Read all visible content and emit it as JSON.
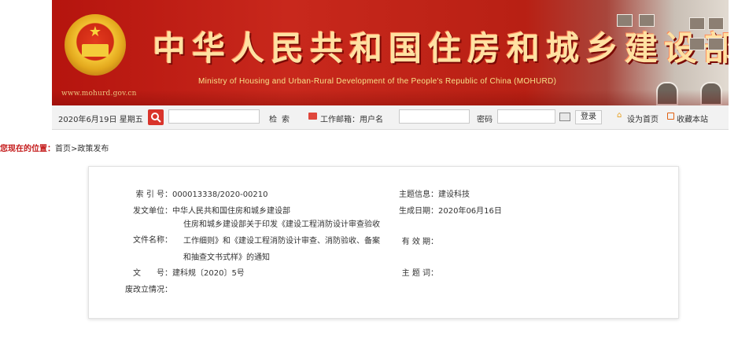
{
  "header": {
    "title_cn": "中华人民共和国住房和城乡建设部",
    "title_en": "Ministry of Housing and Urban-Rural Development of the People's Republic of China (MOHURD)",
    "url": "www.mohurd.gov.cn"
  },
  "toolbar": {
    "date": "2020年6月19日 星期五",
    "search_button": "检索",
    "mail_label": "工作邮箱：用户名",
    "password_label": "密码",
    "login_button": "登录",
    "set_home": "设为首页",
    "bookmark": "收藏本站",
    "search_value": "",
    "username_value": "",
    "password_value": ""
  },
  "location": {
    "label": "您现在的位置：",
    "home": "首页",
    "separator": ">",
    "current": "政策发布"
  },
  "doc": {
    "index_label": "索 引 号：",
    "index_value": "000013338/2020-00210",
    "issuer_label": "发文单位：",
    "issuer_value": "中华人民共和国住房和城乡建设部",
    "filename_label": "文件名称：",
    "filename_lines": [
      "住房和城乡建设部关于印发《建设工程消防设计审查验收",
      "工作细则》和《建设工程消防设计审查、消防验收、备案",
      "和抽查文书式样》的通知"
    ],
    "docno_label": "文　　号：",
    "docno_value": "建科规〔2020〕5号",
    "status_label": "废改立情况：",
    "status_value": "",
    "topic_label": "主题信息：",
    "topic_value": "建设科技",
    "date_label": "生成日期：",
    "date_value": "2020年06月16日",
    "validity_label": "有 效 期：",
    "validity_value": "",
    "keywords_label": "主 题 词：",
    "keywords_value": ""
  },
  "icons": {
    "search": "search-icon",
    "mail": "mail-icon",
    "keyboard": "keyboard-icon",
    "home": "home-icon",
    "bookmark": "bookmark-icon",
    "emblem": "national-emblem"
  },
  "colors": {
    "banner_red": "#b5140e",
    "title_gold": "#ffe1a2",
    "location_red": "#c41a1a"
  }
}
